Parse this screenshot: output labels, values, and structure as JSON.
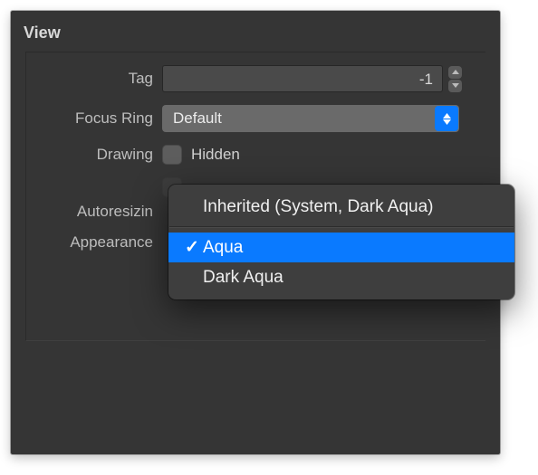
{
  "section": {
    "title": "View"
  },
  "rows": {
    "tag": {
      "label": "Tag",
      "value": "-1"
    },
    "focus_ring": {
      "label": "Focus Ring",
      "value": "Default"
    },
    "drawing": {
      "label": "Drawing",
      "hidden_label": "Hidden"
    },
    "autoresizing": {
      "label": "Autoresizin"
    },
    "appearance": {
      "label": "Appearance"
    }
  },
  "menu": {
    "inherited": "Inherited (System, Dark Aqua)",
    "aqua": "Aqua",
    "dark_aqua": "Dark Aqua",
    "checkmark": "✓"
  }
}
